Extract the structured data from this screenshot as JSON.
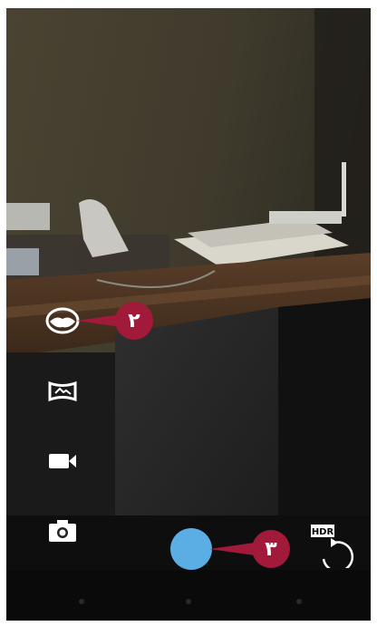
{
  "callouts": [
    {
      "number": "٢",
      "target": "panorama-mode"
    },
    {
      "number": "٣",
      "target": "shutter-button"
    }
  ],
  "modes": [
    {
      "name": "photo-sphere",
      "icon": "photo-sphere-icon",
      "selected": true
    },
    {
      "name": "panorama",
      "icon": "panorama-icon",
      "selected": false
    },
    {
      "name": "video",
      "icon": "video-camera-icon",
      "selected": false
    },
    {
      "name": "camera",
      "icon": "camera-icon",
      "selected": false
    }
  ],
  "hdr": {
    "label": "HDR",
    "icon": "hdr-toggle-icon"
  },
  "colors": {
    "callout": "#a11a3a",
    "shutter": "#5aaee3"
  },
  "nav": {
    "items": [
      "back",
      "home",
      "recents"
    ]
  }
}
